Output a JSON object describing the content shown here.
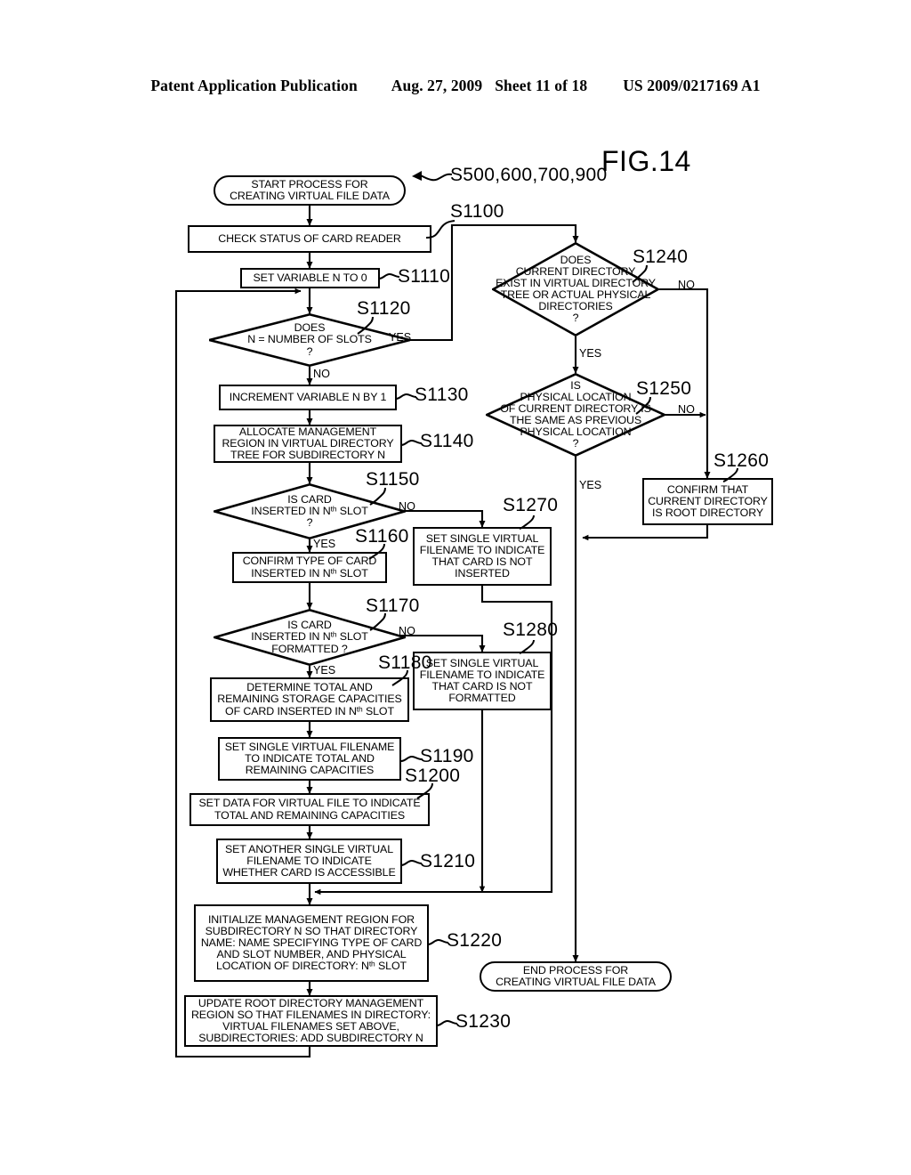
{
  "header": {
    "publication": "Patent Application Publication",
    "date": "Aug. 27, 2009",
    "sheet": "Sheet 11 of 18",
    "patent_number": "US 2009/0217169 A1"
  },
  "figure": {
    "title": "FIG.14"
  },
  "nodes": {
    "start": {
      "id": "start",
      "kind": "terminal",
      "line1": "START PROCESS FOR",
      "line2": "CREATING VIRTUAL FILE DATA"
    },
    "s1100": {
      "id": "S1100",
      "kind": "process",
      "line1": "CHECK STATUS OF CARD READER"
    },
    "s1110": {
      "id": "S1110",
      "kind": "process",
      "line1": "SET VARIABLE N TO 0"
    },
    "s1120": {
      "id": "S1120",
      "kind": "decision",
      "line1": "DOES",
      "line2": "N = NUMBER OF SLOTS",
      "line3": "?"
    },
    "s1130": {
      "id": "S1130",
      "kind": "process",
      "line1": "INCREMENT VARIABLE N BY 1"
    },
    "s1140": {
      "id": "S1140",
      "kind": "process",
      "line1": "ALLOCATE MANAGEMENT",
      "line2": "REGION IN VIRTUAL DIRECTORY",
      "line3": "TREE FOR SUBDIRECTORY N"
    },
    "s1150": {
      "id": "S1150",
      "kind": "decision",
      "line1": "IS CARD",
      "line2": "INSERTED IN N<sup>th</sup> SLOT",
      "line3": "?"
    },
    "s1160": {
      "id": "S1160",
      "kind": "process",
      "line1": "CONFIRM TYPE OF CARD",
      "line2": "INSERTED IN N<sup>th</sup> SLOT"
    },
    "s1170": {
      "id": "S1170",
      "kind": "decision",
      "line1": "IS CARD",
      "line2": "INSERTED IN N<sup>th</sup> SLOT",
      "line3": "FORMATTED ?"
    },
    "s1180": {
      "id": "S1180",
      "kind": "process",
      "line1": "DETERMINE TOTAL AND",
      "line2": "REMAINING STORAGE CAPACITIES",
      "line3": "OF CARD INSERTED IN N<sup>th</sup> SLOT"
    },
    "s1190": {
      "id": "S1190",
      "kind": "process",
      "line1": "SET SINGLE VIRTUAL FILENAME",
      "line2": "TO INDICATE TOTAL AND",
      "line3": "REMAINING CAPACITIES"
    },
    "s1200": {
      "id": "S1200",
      "kind": "process",
      "line1": "SET DATA FOR VIRTUAL FILE TO INDICATE",
      "line2": "TOTAL AND REMAINING CAPACITIES"
    },
    "s1210": {
      "id": "S1210",
      "kind": "process",
      "line1": "SET ANOTHER SINGLE VIRTUAL",
      "line2": "FILENAME TO INDICATE",
      "line3": "WHETHER CARD IS ACCESSIBLE"
    },
    "s1220": {
      "id": "S1220",
      "kind": "process",
      "line1": "INITIALIZE MANAGEMENT REGION FOR",
      "line2": "SUBDIRECTORY N SO THAT DIRECTORY",
      "line3": "NAME: NAME SPECIFYING TYPE OF CARD",
      "line4": "AND SLOT NUMBER, AND PHYSICAL",
      "line5": "LOCATION OF DIRECTORY: N<sup>th</sup> SLOT"
    },
    "s1230": {
      "id": "S1230",
      "kind": "process",
      "line1": "UPDATE ROOT DIRECTORY MANAGEMENT",
      "line2": "REGION SO THAT FILENAMES IN DIRECTORY:",
      "line3": "VIRTUAL FILENAMES SET ABOVE,",
      "line4": "SUBDIRECTORIES: ADD SUBDIRECTORY N"
    },
    "s1240": {
      "id": "S1240",
      "kind": "decision",
      "line1": "DOES",
      "line2": "CURRENT DIRECTORY",
      "line3": "EXIST IN VIRTUAL DIRECTORY",
      "line4": "TREE OR ACTUAL PHYSICAL",
      "line5": "DIRECTORIES",
      "line6": "?"
    },
    "s1250": {
      "id": "S1250",
      "kind": "decision",
      "line1": "IS",
      "line2": "PHYSICAL LOCATION",
      "line3": "OF CURRENT DIRECTORY IS",
      "line4": "THE SAME AS PREVIOUS",
      "line5": "PHYSICAL LOCATION",
      "line6": "?"
    },
    "s1260": {
      "id": "S1260",
      "kind": "process",
      "line1": "CONFIRM THAT",
      "line2": "CURRENT DIRECTORY",
      "line3": "IS ROOT DIRECTORY"
    },
    "s1270": {
      "id": "S1270",
      "kind": "process",
      "line1": "SET SINGLE VIRTUAL",
      "line2": "FILENAME TO INDICATE",
      "line3": "THAT CARD IS NOT",
      "line4": "INSERTED"
    },
    "s1280": {
      "id": "S1280",
      "kind": "process",
      "line1": "SET SINGLE VIRTUAL",
      "line2": "FILENAME TO INDICATE",
      "line3": "THAT CARD IS NOT",
      "line4": "FORMATTED"
    },
    "end": {
      "id": "end",
      "kind": "terminal",
      "line1": "END PROCESS FOR",
      "line2": "CREATING VIRTUAL FILE DATA"
    }
  },
  "step_labels": {
    "start_ref": "S500,600,700,900",
    "s1100": "S1100",
    "s1110": "S1110",
    "s1120": "S1120",
    "s1130": "S1130",
    "s1140": "S1140",
    "s1150": "S1150",
    "s1160": "S1160",
    "s1170": "S1170",
    "s1180": "S1180",
    "s1190": "S1190",
    "s1200": "S1200",
    "s1210": "S1210",
    "s1220": "S1220",
    "s1230": "S1230",
    "s1240": "S1240",
    "s1250": "S1250",
    "s1260": "S1260",
    "s1270": "S1270",
    "s1280": "S1280"
  },
  "branches": {
    "s1120_yes": "YES",
    "s1120_no": "NO",
    "s1150_no": "NO",
    "s1150_yes": "YES",
    "s1170_no": "NO",
    "s1170_yes": "YES",
    "s1240_no": "NO",
    "s1240_yes": "YES",
    "s1250_no": "NO",
    "s1250_yes": "YES"
  },
  "colors": {
    "ink": "#000000",
    "paper": "#ffffff"
  }
}
